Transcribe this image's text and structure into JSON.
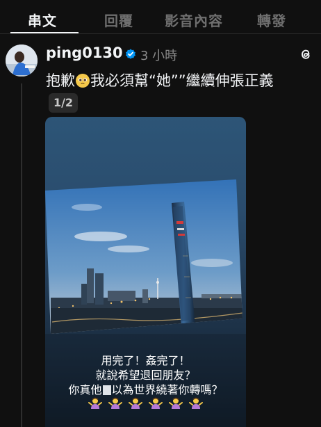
{
  "tabs": [
    {
      "label": "串文",
      "active": true
    },
    {
      "label": "回覆",
      "active": false
    },
    {
      "label": "影音內容",
      "active": false
    },
    {
      "label": "轉發",
      "active": false
    }
  ],
  "post": {
    "username": "ping0130",
    "timestamp": "3 小時",
    "text_before_emoji": "抱歉",
    "emoji": "pleading-face",
    "text_after_emoji": "我必須幫“她””繼續伸張正義",
    "page_indicator": "1/2",
    "media": {
      "caption_lines": [
        "用完了！姦完了！",
        "就說希望退回朋友？",
        "你真他",
        "以為世界繞著你轉嗎？"
      ],
      "emoji_row": "person-shrugging",
      "emoji_count": 6
    }
  },
  "colors": {
    "background": "#101010",
    "text": "#f3f5f7",
    "muted": "#8a8a8a",
    "verified": "#0095f6"
  },
  "icons": [
    "verified-badge-icon",
    "threads-logo-icon"
  ]
}
